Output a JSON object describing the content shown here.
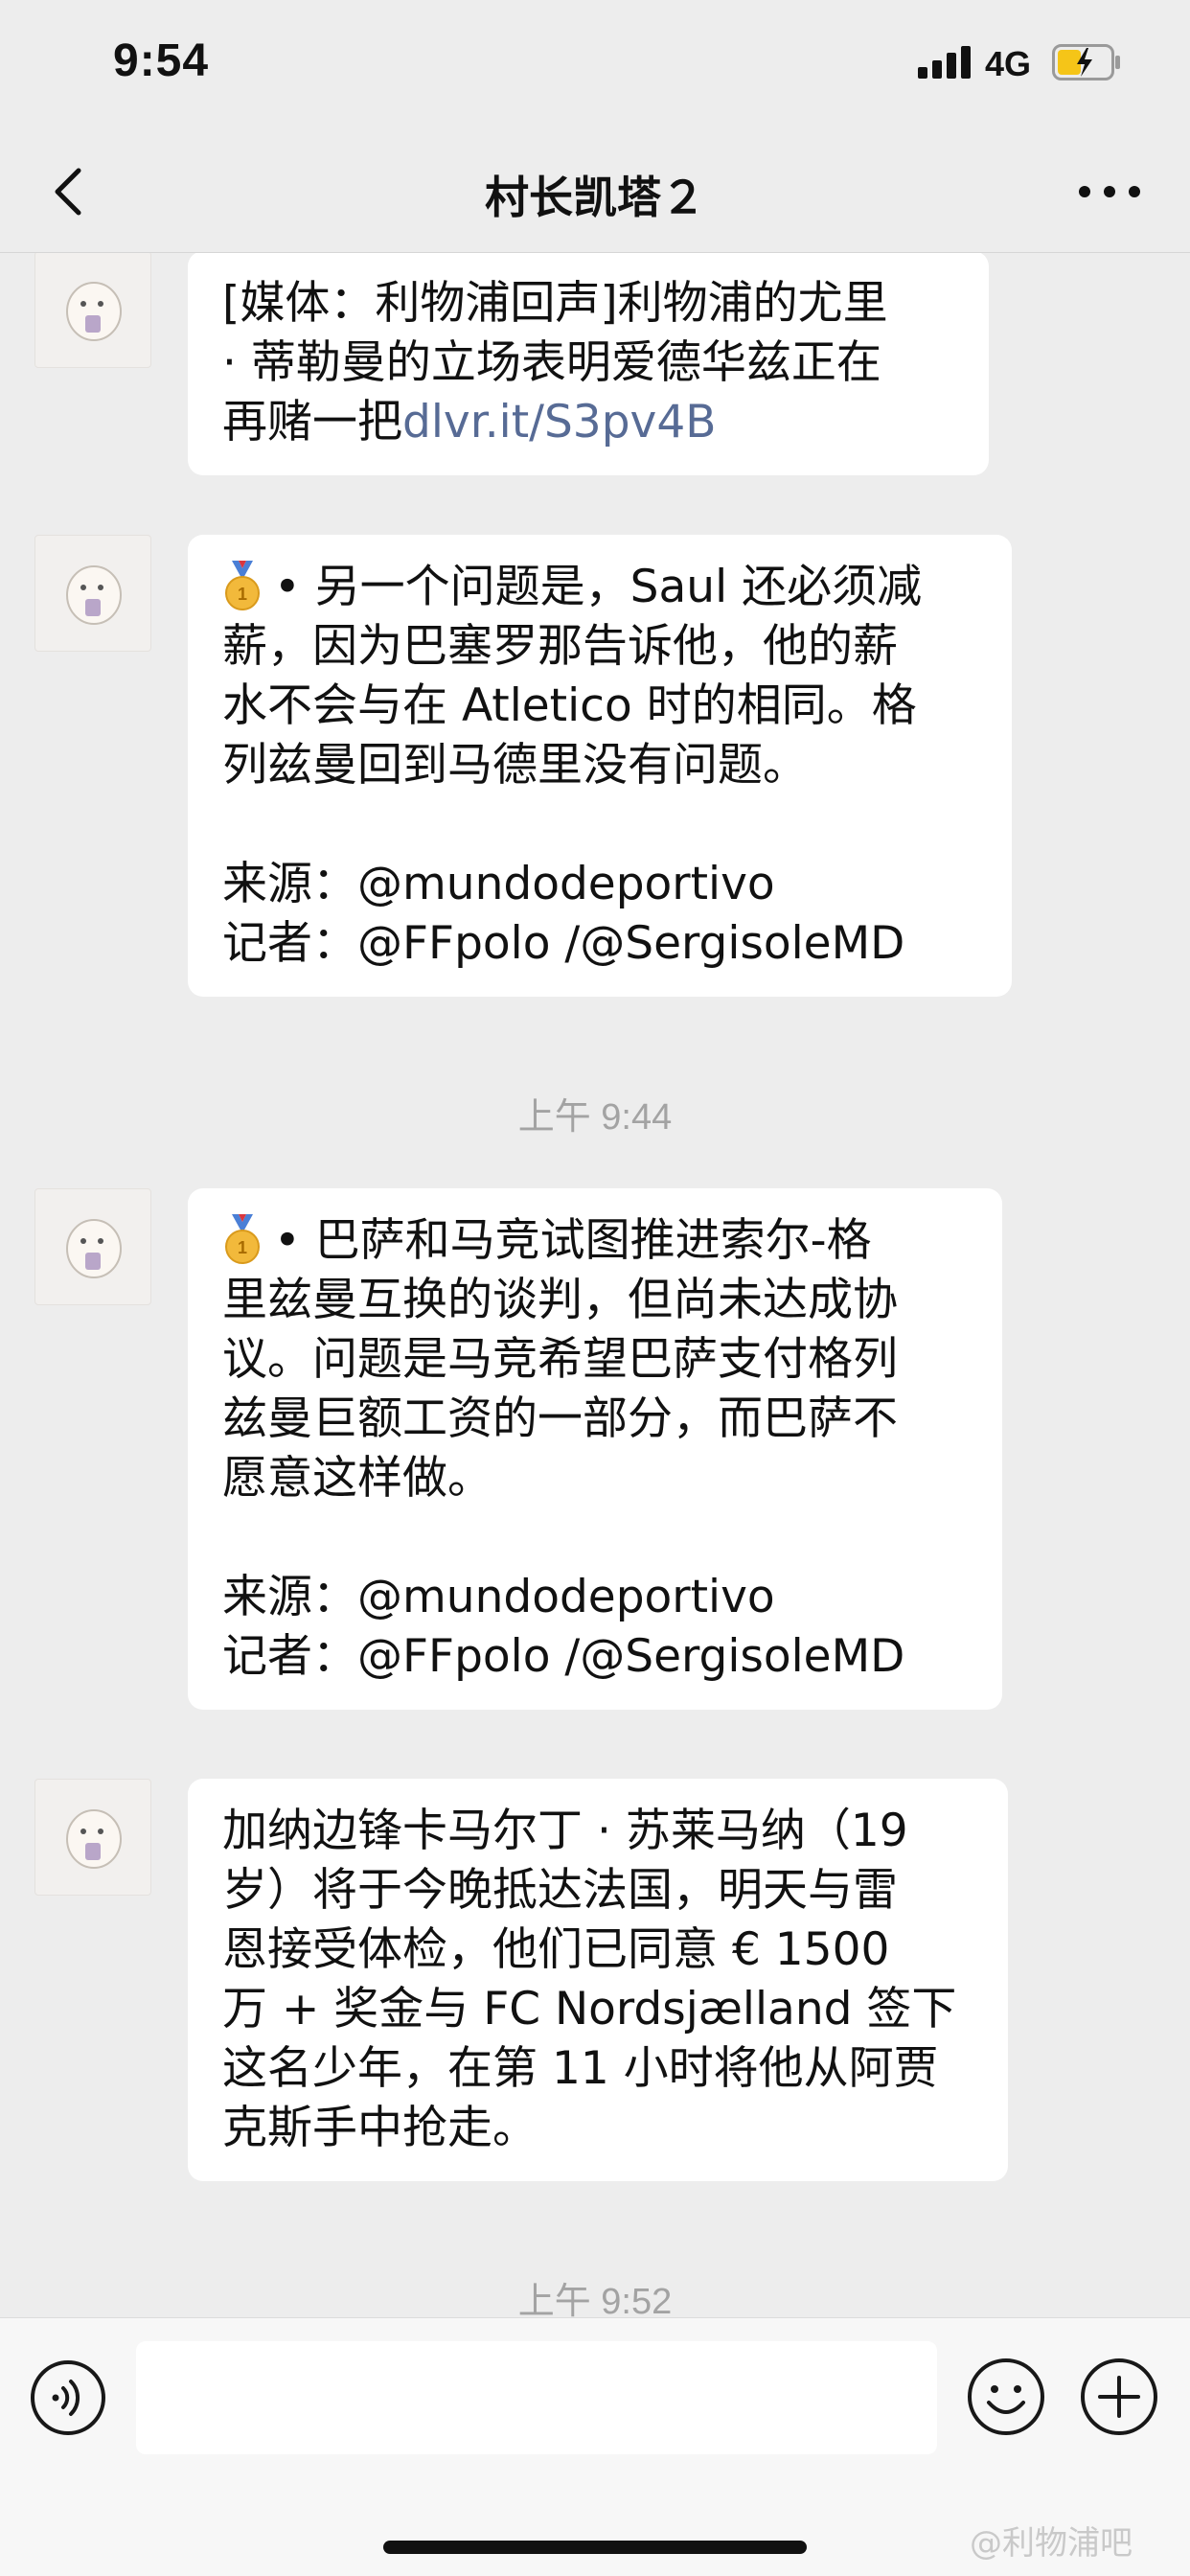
{
  "status_bar": {
    "time": "9:54",
    "network": "4G",
    "icons": [
      "signal-icon",
      "battery-charging-icon"
    ]
  },
  "nav": {
    "title": "村长凯塔２",
    "icons": [
      "back-chevron-icon",
      "more-dots-icon"
    ]
  },
  "messages": [
    {
      "type": "text",
      "lines": [
        "[媒体：利物浦回声]利物浦的尤里",
        "· 蒂勒曼的立场表明爱德华兹正在"
      ],
      "last_line_prefix": "再赌一把",
      "link": "dlvr.it/S3pv4B"
    },
    {
      "type": "text",
      "has_medal": true,
      "lines": [
        "• 另一个问题是，Saul 还必须减",
        "薪，因为巴塞罗那告诉他，他的薪",
        "水不会与在 Atletico 时的相同。格",
        "列兹曼回到马德里没有问题。"
      ],
      "source": "来源：@mundodeportivo",
      "reporter": "记者：@FFpolo /@SergisoleMD"
    },
    {
      "type": "timestamp",
      "text": "上午 9:44"
    },
    {
      "type": "text",
      "has_medal": true,
      "lines": [
        "• 巴萨和马竞试图推进索尔-格",
        "里兹曼互换的谈判，但尚未达成协",
        "议。问题是马竞希望巴萨支付格列",
        "兹曼巨额工资的一部分，而巴萨不",
        "愿意这样做。"
      ],
      "source": "来源：@mundodeportivo",
      "reporter": "记者：@FFpolo /@SergisoleMD"
    },
    {
      "type": "text",
      "lines": [
        "加纳边锋卡马尔丁 · 苏莱马纳（19",
        "岁）将于今晚抵达法国，明天与雷",
        "恩接受体检，他们已同意 € 1500",
        "万 + 奖金与 FC Nordsjælland 签下",
        "这名少年，在第 11 小时将他从阿贾",
        "克斯手中抢走。"
      ]
    },
    {
      "type": "timestamp",
      "text": "上午 9:52"
    }
  ],
  "input_bar": {
    "placeholder": "",
    "icons": [
      "voice-icon",
      "emoji-icon",
      "plus-icon"
    ]
  },
  "watermark": "@利物浦吧",
  "colors": {
    "background": "#ededed",
    "bubble": "#ffffff",
    "link": "#576b95",
    "timestamp": "#a3a3a3"
  }
}
